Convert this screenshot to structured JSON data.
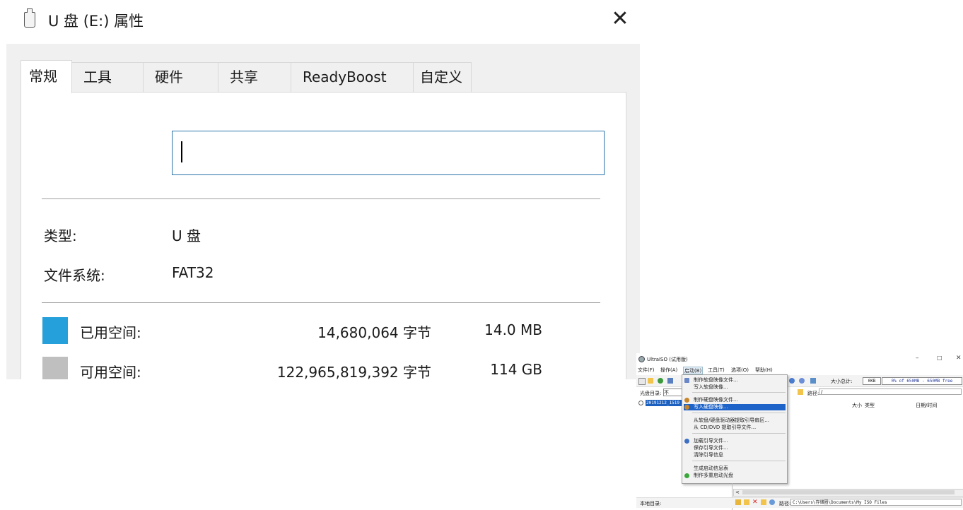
{
  "dialog": {
    "title": "U 盘 (E:) 属性",
    "close_glyph": "✕",
    "tabs": [
      "常规",
      "工具",
      "硬件",
      "共享",
      "ReadyBoost",
      "自定义"
    ],
    "active_tab": "常规",
    "volume_label_value": "",
    "type_label": "类型:",
    "type_value": "U 盘",
    "fs_label": "文件系统:",
    "fs_value": "FAT32",
    "used_label": "已用空间:",
    "used_bytes": "14,680,064 字节",
    "used_size": "14.0 MB",
    "free_label": "可用空间:",
    "free_bytes": "122,965,819,392 字节",
    "free_size": "114 GB",
    "colors": {
      "used": "#26a0da",
      "free": "#bfbfbf",
      "input_border": "#2b74a8"
    }
  },
  "ultraiso": {
    "title": "UltraISO (试用版)",
    "window_controls": {
      "minimize": "–",
      "maximize": "□",
      "close": "✕"
    },
    "menu": [
      "文件(F)",
      "操作(A)",
      "启动(B)",
      "工具(T)",
      "选项(O)",
      "帮助(H)"
    ],
    "active_menu": "启动(B)",
    "total_size_label": "大小总计:",
    "total_size_value": "0KB",
    "capacity_bar_text": "0% of 650MB - 650MB free",
    "disc_dir_label": "光盘目录:",
    "disc_dir_box": "不",
    "path_label": "路径:",
    "path_value": "/",
    "tree_item": "20191212_1519",
    "columns": {
      "size": "大小",
      "type": "类型",
      "date": "日期/时间"
    },
    "boot_menu": [
      {
        "label": "制作软盘映像文件...",
        "icon": "floppy-icon",
        "highlight": false
      },
      {
        "label": "写入软盘映像...",
        "icon": "",
        "highlight": false
      },
      {
        "label": "制作硬盘映像文件...",
        "icon": "harddisk-icon",
        "highlight": false
      },
      {
        "label": "写入硬盘映像...",
        "icon": "harddisk-write-icon",
        "highlight": true
      },
      {
        "label": "从软盘/硬盘驱动器提取引导扇区...",
        "icon": "",
        "highlight": false
      },
      {
        "label": "从 CD/DVD 提取引导文件...",
        "icon": "",
        "highlight": false
      },
      {
        "label": "加载引导文件...",
        "icon": "gear-icon",
        "highlight": false
      },
      {
        "label": "保存引导文件...",
        "icon": "",
        "highlight": false
      },
      {
        "label": "清除引导信息",
        "icon": "",
        "highlight": false
      },
      {
        "label": "生成启动信息表",
        "icon": "",
        "highlight": false
      },
      {
        "label": "制作多重启动光盘",
        "icon": "green-disc-icon",
        "highlight": false
      }
    ],
    "scroll_left_arrow": "<",
    "local_dir_label": "本地目录:",
    "bottom_path_label": "路径:",
    "bottom_path_value": "C:\\Users\\存储圈\\Documents\\My ISO Files"
  }
}
